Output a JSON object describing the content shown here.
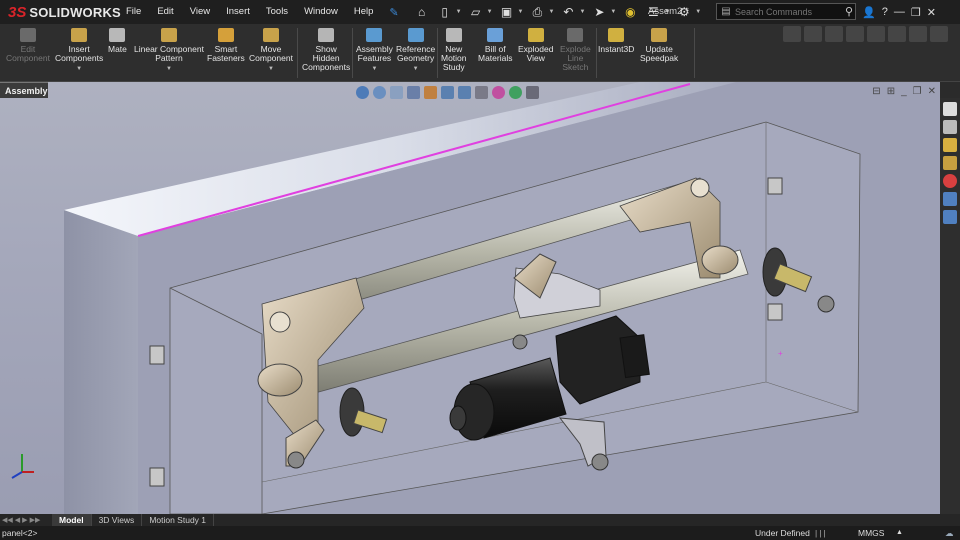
{
  "app": {
    "brand": "SOLIDWORKS",
    "document_title": "Assem2 *"
  },
  "menu": [
    "File",
    "Edit",
    "View",
    "Insert",
    "Tools",
    "Window",
    "Help"
  ],
  "search": {
    "placeholder": "Search Commands"
  },
  "commands": [
    {
      "label": "Edit\nComponent",
      "icon": "edit-component-icon",
      "disabled": true,
      "color": "#6a6a6a"
    },
    {
      "label": "Insert\nComponents",
      "icon": "insert-components-icon",
      "disabled": false,
      "color": "#c8a24a",
      "dropdown": true
    },
    {
      "label": "Mate",
      "icon": "mate-icon",
      "disabled": false,
      "color": "#b8b8b8"
    },
    {
      "label": "Linear Component\nPattern",
      "icon": "linear-pattern-icon",
      "disabled": false,
      "color": "#c8a24a",
      "dropdown": true
    },
    {
      "label": "Smart\nFasteners",
      "icon": "smart-fasteners-icon",
      "disabled": false,
      "color": "#d5a03a"
    },
    {
      "label": "Move\nComponent",
      "icon": "move-component-icon",
      "disabled": false,
      "color": "#c8a24a",
      "dropdown": true
    },
    {
      "label": "Show\nHidden\nComponents",
      "icon": "show-hidden-icon",
      "disabled": false,
      "color": "#b5b5b5"
    },
    {
      "label": "Assembly\nFeatures",
      "icon": "assembly-features-icon",
      "disabled": false,
      "color": "#5a9ad0",
      "dropdown": true
    },
    {
      "label": "Reference\nGeometry",
      "icon": "reference-geometry-icon",
      "disabled": false,
      "color": "#5a9ad0",
      "dropdown": true
    },
    {
      "label": "New\nMotion\nStudy",
      "icon": "motion-study-icon",
      "disabled": false,
      "color": "#b8b8b8"
    },
    {
      "label": "Bill of\nMaterials",
      "icon": "bom-icon",
      "disabled": false,
      "color": "#6aa0d8"
    },
    {
      "label": "Exploded\nView",
      "icon": "exploded-view-icon",
      "disabled": false,
      "color": "#d0b040"
    },
    {
      "label": "Explode\nLine\nSketch",
      "icon": "explode-line-icon",
      "disabled": true,
      "color": "#6a6a6a"
    },
    {
      "label": "Instant3D",
      "icon": "instant3d-icon",
      "disabled": false,
      "color": "#d0b040"
    },
    {
      "label": "Update\nSpeedpak",
      "icon": "speedpak-icon",
      "disabled": false,
      "color": "#c8a24a"
    }
  ],
  "tabs": {
    "assembly": "Assembly"
  },
  "bottom_tabs": [
    "Model",
    "3D Views",
    "Motion Study 1"
  ],
  "status": {
    "left": "panel<2>",
    "definition": "Under Defined",
    "units": "MMGS"
  },
  "colors": {
    "accent_magenta": "#e040e0",
    "brand_red": "#d9242a"
  }
}
